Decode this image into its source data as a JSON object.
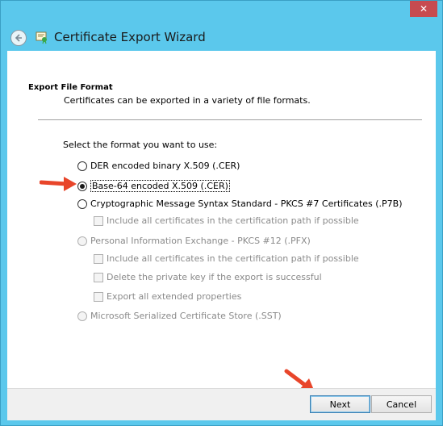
{
  "window": {
    "title": "Certificate Export Wizard",
    "close_symbol": "✕"
  },
  "page": {
    "heading": "Export File Format",
    "description": "Certificates can be exported in a variety of file formats.",
    "prompt": "Select the format you want to use:"
  },
  "options": {
    "der": "DER encoded binary X.509 (.CER)",
    "base64": "Base-64 encoded X.509 (.CER)",
    "pkcs7": "Cryptographic Message Syntax Standard - PKCS #7 Certificates (.P7B)",
    "pkcs7_include": "Include all certificates in the certification path if possible",
    "pfx": "Personal Information Exchange - PKCS #12 (.PFX)",
    "pfx_include": "Include all certificates in the certification path if possible",
    "pfx_delete_key": "Delete the private key if the export is successful",
    "pfx_export_props": "Export all extended properties",
    "sst": "Microsoft Serialized Certificate Store (.SST)"
  },
  "selected_option": "base64",
  "buttons": {
    "next": "Next",
    "cancel": "Cancel"
  },
  "colors": {
    "title_bar": "#5bc8ec",
    "close_button": "#c74b50",
    "annotation_arrow": "#e8452a"
  },
  "icons": {
    "back": "back-arrow-icon",
    "wizard": "certificate-icon",
    "close": "close-icon"
  }
}
